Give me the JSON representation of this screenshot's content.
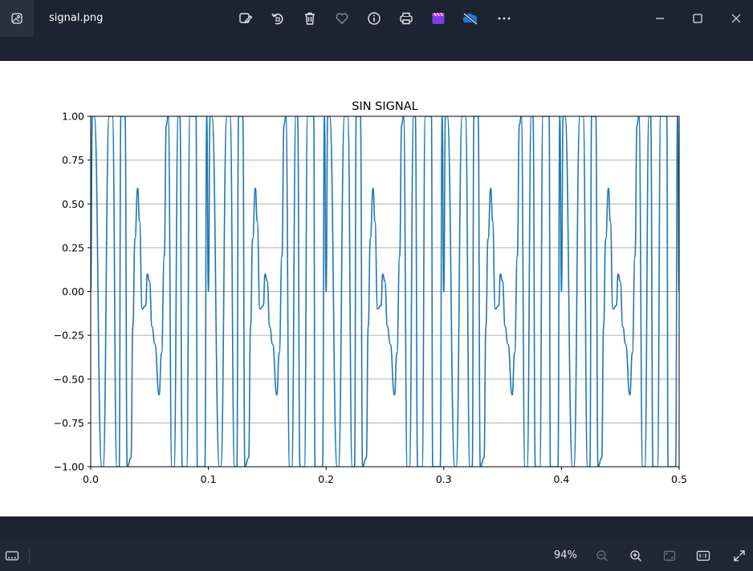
{
  "window": {
    "file_name": "signal.png"
  },
  "toolbar": [
    {
      "name": "edit-image-icon"
    },
    {
      "name": "rotate-icon"
    },
    {
      "name": "delete-icon"
    },
    {
      "name": "favorite-icon"
    },
    {
      "name": "info-icon"
    },
    {
      "name": "print-icon"
    },
    {
      "name": "clipchamp-icon"
    },
    {
      "name": "onedrive-icon"
    },
    {
      "name": "more-icon"
    }
  ],
  "status": {
    "zoom": "94%"
  },
  "chart_data": {
    "type": "line",
    "title": "SIN SIGNAL",
    "xlim": [
      0.0,
      0.5
    ],
    "ylim": [
      -1.0,
      1.0
    ],
    "x_ticks": [
      "0.0",
      "0.1",
      "0.2",
      "0.3",
      "0.4",
      "0.5"
    ],
    "y_ticks": [
      "1.00",
      "0.75",
      "0.50",
      "0.25",
      "0.00",
      "−0.25",
      "−0.50",
      "−0.75",
      "−1.00"
    ],
    "y_tick_values": [
      1.0,
      0.75,
      0.5,
      0.25,
      0.0,
      -0.25,
      -0.5,
      -0.75,
      -1.0
    ],
    "x_tick_values": [
      0.0,
      0.1,
      0.2,
      0.3,
      0.4,
      0.5
    ],
    "grid": "horizontal",
    "series": [
      {
        "color": "#1f77b4",
        "x": [
          0.0,
          0.0014,
          0.003,
          0.0094,
          0.0105,
          0.0157,
          0.0184,
          0.0222,
          0.0242,
          0.0256,
          0.0292,
          0.031,
          0.0342,
          0.0358,
          0.0376,
          0.0399,
          0.0415,
          0.0437,
          0.0467,
          0.0481,
          0.0499,
          0.0521,
          0.0545,
          0.0581,
          0.0602,
          0.0625,
          0.0642,
          0.0658,
          0.069,
          0.0708,
          0.0744,
          0.0758,
          0.0778,
          0.0816,
          0.0843,
          0.0895,
          0.0906,
          0.097,
          0.0986,
          0.1
        ],
        "y": [
          0.0,
          1.0,
          1.0,
          -1.0,
          -1.0,
          1.0,
          1.0,
          -1.0,
          -1.0,
          1.0,
          1.0,
          -1.0,
          -0.95,
          -0.2,
          0.3,
          0.59,
          0.4,
          -0.1,
          -0.08,
          0.1,
          0.06,
          -0.2,
          -0.3,
          -0.59,
          -0.35,
          0.2,
          0.95,
          1.0,
          -1.0,
          -1.0,
          1.0,
          1.0,
          -1.0,
          -1.0,
          1.0,
          1.0,
          -1.0,
          -1.0,
          1.0,
          0.0
        ],
        "period": 0.1
      }
    ]
  }
}
